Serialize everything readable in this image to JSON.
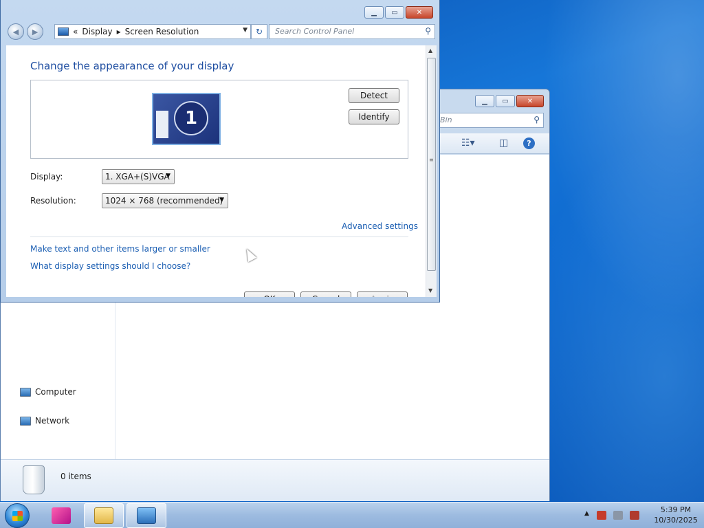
{
  "screen_resolution_window": {
    "breadcrumb_chevron": "«",
    "breadcrumb_display": "Display",
    "breadcrumb_separator": "▸",
    "breadcrumb_page": "Screen Resolution",
    "search_placeholder": "Search Control Panel",
    "title": "Change the appearance of your display",
    "monitor_number": "1",
    "detect_label": "Detect",
    "identify_label": "Identify",
    "display_label": "Display:",
    "display_value": "1. XGA+(S)VGA",
    "resolution_label": "Resolution:",
    "resolution_value": "1024 × 768 (recommended)",
    "advanced_settings": "Advanced settings",
    "link_text_size": "Make text and other items larger or smaller",
    "link_what_settings": "What display settings should I choose?",
    "ok_label": "OK",
    "cancel_label": "Cancel",
    "apply_label": "Apply"
  },
  "recycle_bin_window": {
    "search_placeholder_fragment": "Bin",
    "nav_items": [
      {
        "label": "Computer",
        "icon": "computer-icon"
      },
      {
        "label": "Network",
        "icon": "network-icon"
      }
    ],
    "status_items": "0 items"
  },
  "taskbar": {
    "time": "5:39 PM",
    "date": "10/30/2025"
  },
  "colors": {
    "link": "#1c5fb3",
    "title_blue": "#1f4ea1",
    "desktop_blue": "#1676d8"
  }
}
